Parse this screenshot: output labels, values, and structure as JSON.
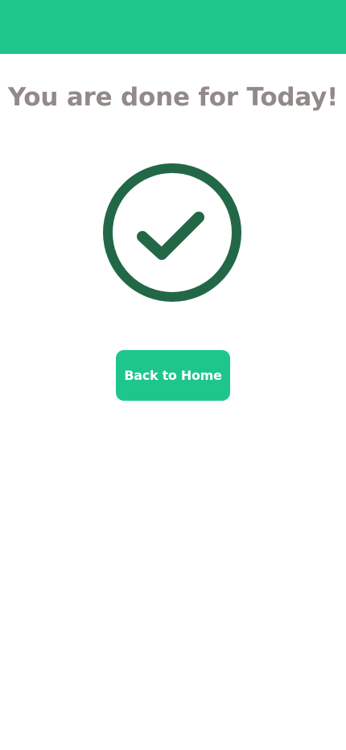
{
  "header": {
    "color": "#1fc68c"
  },
  "main": {
    "title": "You are done for Today!",
    "icon": "check-circle-icon",
    "icon_color": "#226847",
    "home_button_label": "Back to Home"
  }
}
